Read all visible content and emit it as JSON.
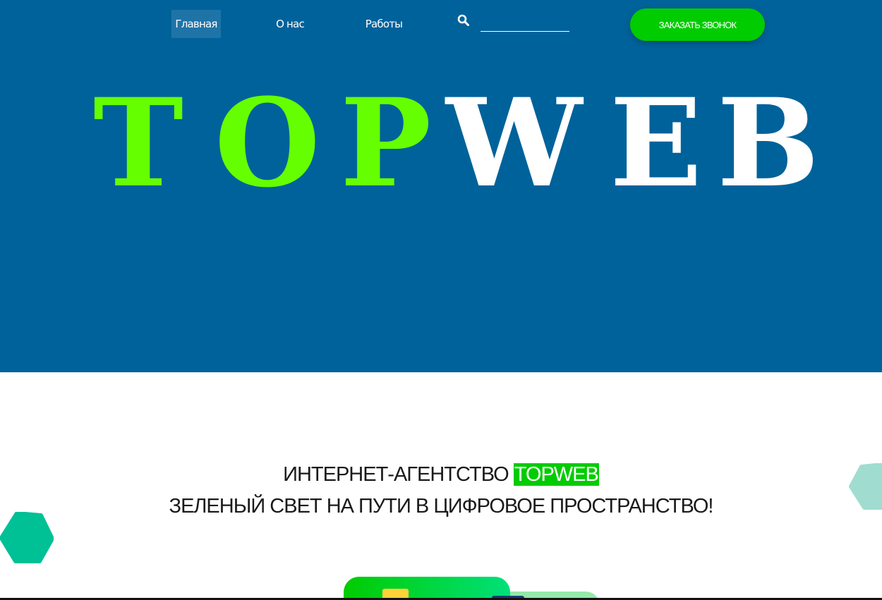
{
  "nav": {
    "items": [
      {
        "label": "Главная",
        "active": true
      },
      {
        "label": "О нас",
        "active": false
      },
      {
        "label": "Работы",
        "active": false
      }
    ],
    "search": {
      "icon": "search-icon",
      "value": "",
      "placeholder": ""
    },
    "call_button": "ЗАКАЗАТЬ ЗВОНОК"
  },
  "hero": {
    "logo_part1": [
      "T",
      "O",
      "P"
    ],
    "logo_part2": [
      "W",
      "E",
      "B"
    ],
    "background": "#00629b",
    "accent": "#66ff00"
  },
  "intro": {
    "line1_prefix": "ИНТЕРНЕТ-АГЕНТСТВО",
    "line1_highlight": "TOPWEB",
    "line2": "ЗЕЛЕНЫЙ СВЕТ НА ПУТИ В ЦИФРОВОЕ ПРОСТРАНСТВО!"
  },
  "colors": {
    "brand_green": "#00cc00",
    "hex_left": "#00c096",
    "hex_right": "#a0ddd0"
  }
}
